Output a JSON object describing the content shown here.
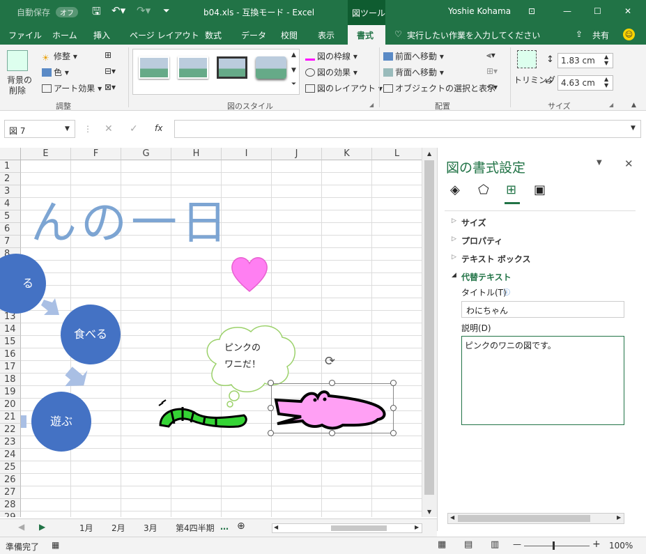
{
  "titlebar": {
    "autosave": "自動保存",
    "autosave_state": "オフ",
    "filename": "b04.xls",
    "mode": "互換モード",
    "app": "Excel",
    "context": "図ツール",
    "user": "Yoshie Kohama"
  },
  "tabs": [
    "ファイル",
    "ホーム",
    "挿入",
    "ページ レイアウト",
    "数式",
    "データ",
    "校閲",
    "表示",
    "書式"
  ],
  "tellme": "実行したい作業を入力してください",
  "share": "共有",
  "ribbon": {
    "remove_bg": [
      "背景の",
      "削除"
    ],
    "corrections": "修整",
    "color": "色",
    "artistic": "アート効果",
    "adjust_group": "調整",
    "pic_styles_group": "図のスタイル",
    "border": "図の枠線",
    "effects": "図の効果",
    "layout": "図のレイアウト",
    "bring_forward": "前面へ移動",
    "send_backward": "背面へ移動",
    "selection_pane": "オブジェクトの選択と表示",
    "arrange_group": "配置",
    "crop": "トリミング",
    "height": "1.83 cm",
    "width": "4.63 cm",
    "size_group": "サイズ"
  },
  "formula": {
    "namebox": "図 7",
    "value": ""
  },
  "columns": [
    "E",
    "F",
    "G",
    "H",
    "I",
    "J",
    "K",
    "L"
  ],
  "rows": [
    "1",
    "2",
    "3",
    "4",
    "5",
    "6",
    "7",
    "8",
    "9",
    "10",
    "11",
    "12",
    "13",
    "14",
    "15",
    "16",
    "17",
    "18",
    "19",
    "20",
    "21",
    "22",
    "23",
    "24",
    "25",
    "26",
    "27",
    "28",
    "29"
  ],
  "sheet": {
    "wordart": "んの一日",
    "circle1": "る",
    "circle2": "食べる",
    "circle3": "遊ぶ",
    "bubble_line1": "ピンクの",
    "bubble_line2": "ワニだ！"
  },
  "pane": {
    "title": "図の書式設定",
    "sections": [
      "サイズ",
      "プロパティ",
      "テキスト ボックス",
      "代替テキスト"
    ],
    "title_label": "タイトル(T)",
    "title_value": "わにちゃん",
    "desc_label": "説明(D)",
    "desc_value": "ピンクのワニの図です。"
  },
  "sheettabs": [
    "1月",
    "2月",
    "3月",
    "第4四半期"
  ],
  "status": {
    "ready": "準備完了",
    "zoom": "100%"
  },
  "colors": {
    "green": "#217346",
    "circle": "#4472c4"
  }
}
